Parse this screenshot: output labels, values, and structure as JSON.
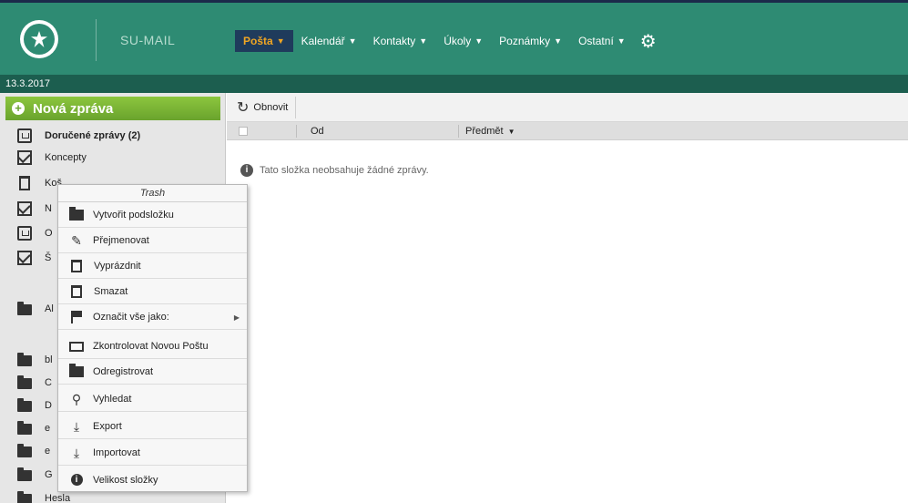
{
  "app": {
    "brand": "SU-MAIL",
    "date": "13.3.2017"
  },
  "nav": [
    {
      "label": "Pošta",
      "active": true
    },
    {
      "label": "Kalendář"
    },
    {
      "label": "Kontakty"
    },
    {
      "label": "Úkoly"
    },
    {
      "label": "Poznámky"
    },
    {
      "label": "Ostatní"
    }
  ],
  "sidebar": {
    "new_message": "Nová zpráva",
    "folders": [
      {
        "label": "Doručené zprávy (2)",
        "icon": "inbox-icon",
        "bold": true
      },
      {
        "label": "Koncepty",
        "icon": "drafts-icon"
      },
      {
        "label": "Koš",
        "icon": "trash-icon"
      },
      {
        "label": "N",
        "icon": "new-mail-icon"
      },
      {
        "label": "O",
        "icon": "outbox-icon"
      },
      {
        "label": "Š",
        "icon": "envelope-icon"
      },
      {
        "label": "Al",
        "icon": "folder-icon"
      },
      {
        "label": "bl",
        "icon": "folder-icon"
      },
      {
        "label": "C",
        "icon": "folder-icon"
      },
      {
        "label": "D",
        "icon": "folder-icon"
      },
      {
        "label": "e",
        "icon": "folder-icon"
      },
      {
        "label": "e",
        "icon": "folder-icon"
      },
      {
        "label": "G",
        "icon": "folder-icon"
      },
      {
        "label": "Hesla",
        "icon": "folder-icon"
      }
    ]
  },
  "toolbar": {
    "refresh_label": "Obnovit"
  },
  "table": {
    "col_from": "Od",
    "col_subject": "Předmět"
  },
  "empty_message": "Tato složka neobsahuje žádné zprávy.",
  "context_menu": {
    "title": "Trash",
    "items": [
      {
        "label": "Vytvořit podsložku",
        "icon": "folder-plus-icon"
      },
      {
        "label": "Přejmenovat",
        "icon": "edit-icon"
      },
      {
        "label": "Vyprázdnit",
        "icon": "trash-icon"
      },
      {
        "label": "Smazat",
        "icon": "trash-icon"
      },
      {
        "label": "Označit vše jako:",
        "icon": "flag-icon",
        "submenu": true
      },
      {
        "label": "Zkontrolovat Novou Poštu",
        "icon": "mail-check-icon"
      },
      {
        "label": "Odregistrovat",
        "icon": "folder-icon"
      },
      {
        "label": "Vyhledat",
        "icon": "search-icon"
      },
      {
        "label": "Export",
        "icon": "download-icon"
      },
      {
        "label": "Importovat",
        "icon": "download-icon"
      },
      {
        "label": "Velikost složky",
        "icon": "info-icon"
      }
    ]
  },
  "colors": {
    "header": "#2e8b73",
    "datebar": "#1c5e4f",
    "active_nav": "#1f3b5c",
    "active_nav_text": "#f0a623",
    "new_message": "#7ab535"
  }
}
